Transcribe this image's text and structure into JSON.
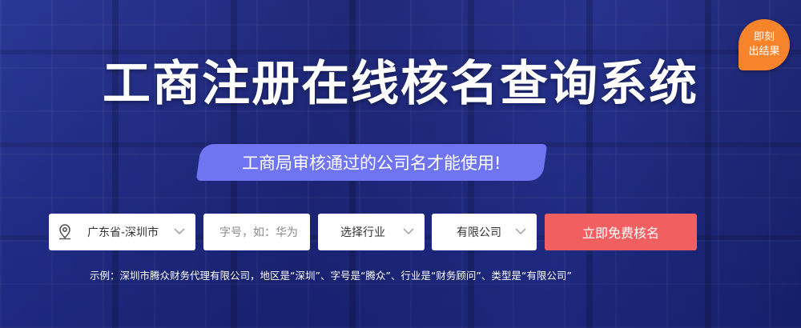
{
  "title": "工商注册在线核名查询系统",
  "badge": {
    "line1": "即刻",
    "line2": "出结果"
  },
  "subtitle": "工商局审核通过的公司名才能使用!",
  "form": {
    "region": {
      "value": "广东省-深圳市"
    },
    "brand": {
      "placeholder": "字号，如：华为"
    },
    "industry": {
      "value": "选择行业"
    },
    "company_type": {
      "value": "有限公司"
    },
    "submit_label": "立即免费核名"
  },
  "example": "示例：深圳市腾众财务代理有限公司，地区是“深圳”、字号是“腾众”、行业是“财务顾问”、类型是“有限公司”",
  "icons": [
    "location-pin-icon",
    "chevron-down-icon"
  ],
  "colors": {
    "badge": "#f7842a",
    "subtitle_bg": "#6f74f0",
    "submit_bg": "#f25f61"
  }
}
